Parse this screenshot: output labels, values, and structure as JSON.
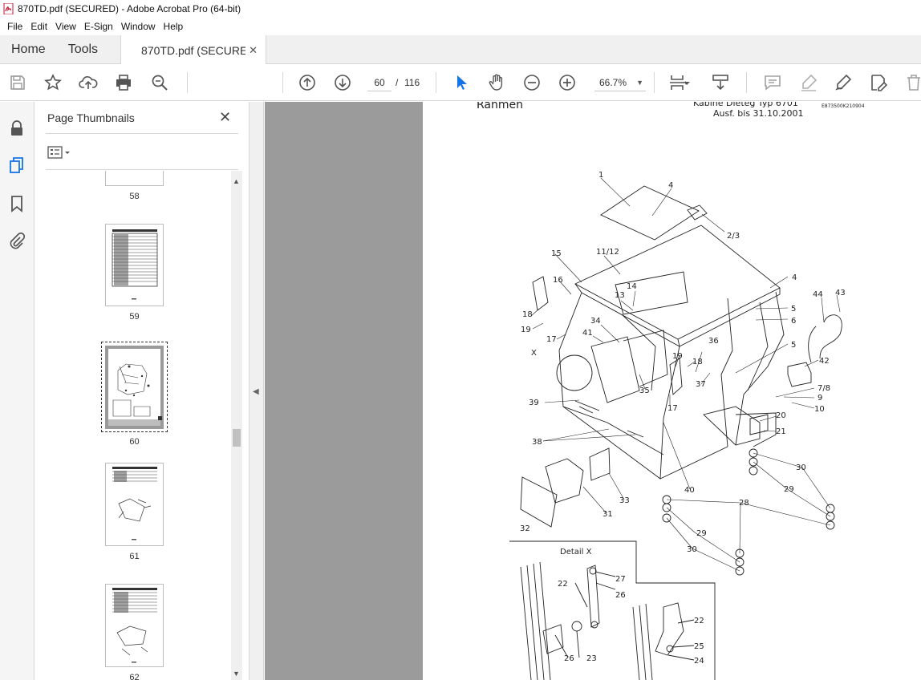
{
  "window": {
    "title": "870TD.pdf (SECURED) - Adobe Acrobat Pro (64-bit)",
    "accent": "#c8102e"
  },
  "menu": [
    "File",
    "Edit",
    "View",
    "E-Sign",
    "Window",
    "Help"
  ],
  "tabs": {
    "home": "Home",
    "tools": "Tools",
    "document": "870TD.pdf (SECURE...",
    "close_glyph": "✕"
  },
  "toolbar": {
    "icons": [
      "save-icon",
      "star-icon",
      "upload-icon",
      "print-icon",
      "search-zoom-icon",
      "prev-page-icon",
      "next-page-icon",
      "select-arrow-icon",
      "hand-icon",
      "zoom-out-icon",
      "zoom-in-icon",
      "fit-page-icon",
      "scroll-mode-icon",
      "comment-icon",
      "highlight-icon",
      "sign-icon",
      "edit-icon",
      "delete-icon"
    ],
    "page_current": "60",
    "page_separator": "/",
    "page_total": "116",
    "zoom": "66.7%"
  },
  "sidebar": {
    "panel_title": "Page Thumbnails",
    "thumbnails": [
      {
        "label": "58"
      },
      {
        "label": "59"
      },
      {
        "label": "60",
        "selected": true
      },
      {
        "label": "61"
      },
      {
        "label": "62"
      }
    ]
  },
  "document_page": {
    "header_left": "Rahmen",
    "header_right_1": "Kabine Dieteg Typ 6701",
    "header_right_2": "Ausf. bis 31.10.2001",
    "header_code": "E873500K210904",
    "detail_title": "Detail X",
    "callouts": [
      "1",
      "4",
      "2/3",
      "15",
      "11/12",
      "16",
      "14",
      "13",
      "4",
      "5",
      "6",
      "44",
      "43",
      "18",
      "19",
      "34",
      "41",
      "17",
      "X",
      "5",
      "36",
      "42",
      "19",
      "18",
      "37",
      "7/8",
      "9",
      "10",
      "35",
      "17",
      "39",
      "20",
      "21",
      "38",
      "30",
      "29",
      "33",
      "40",
      "28",
      "31",
      "32",
      "29",
      "30",
      "22",
      "27",
      "26",
      "22",
      "26",
      "23",
      "25",
      "24"
    ]
  }
}
